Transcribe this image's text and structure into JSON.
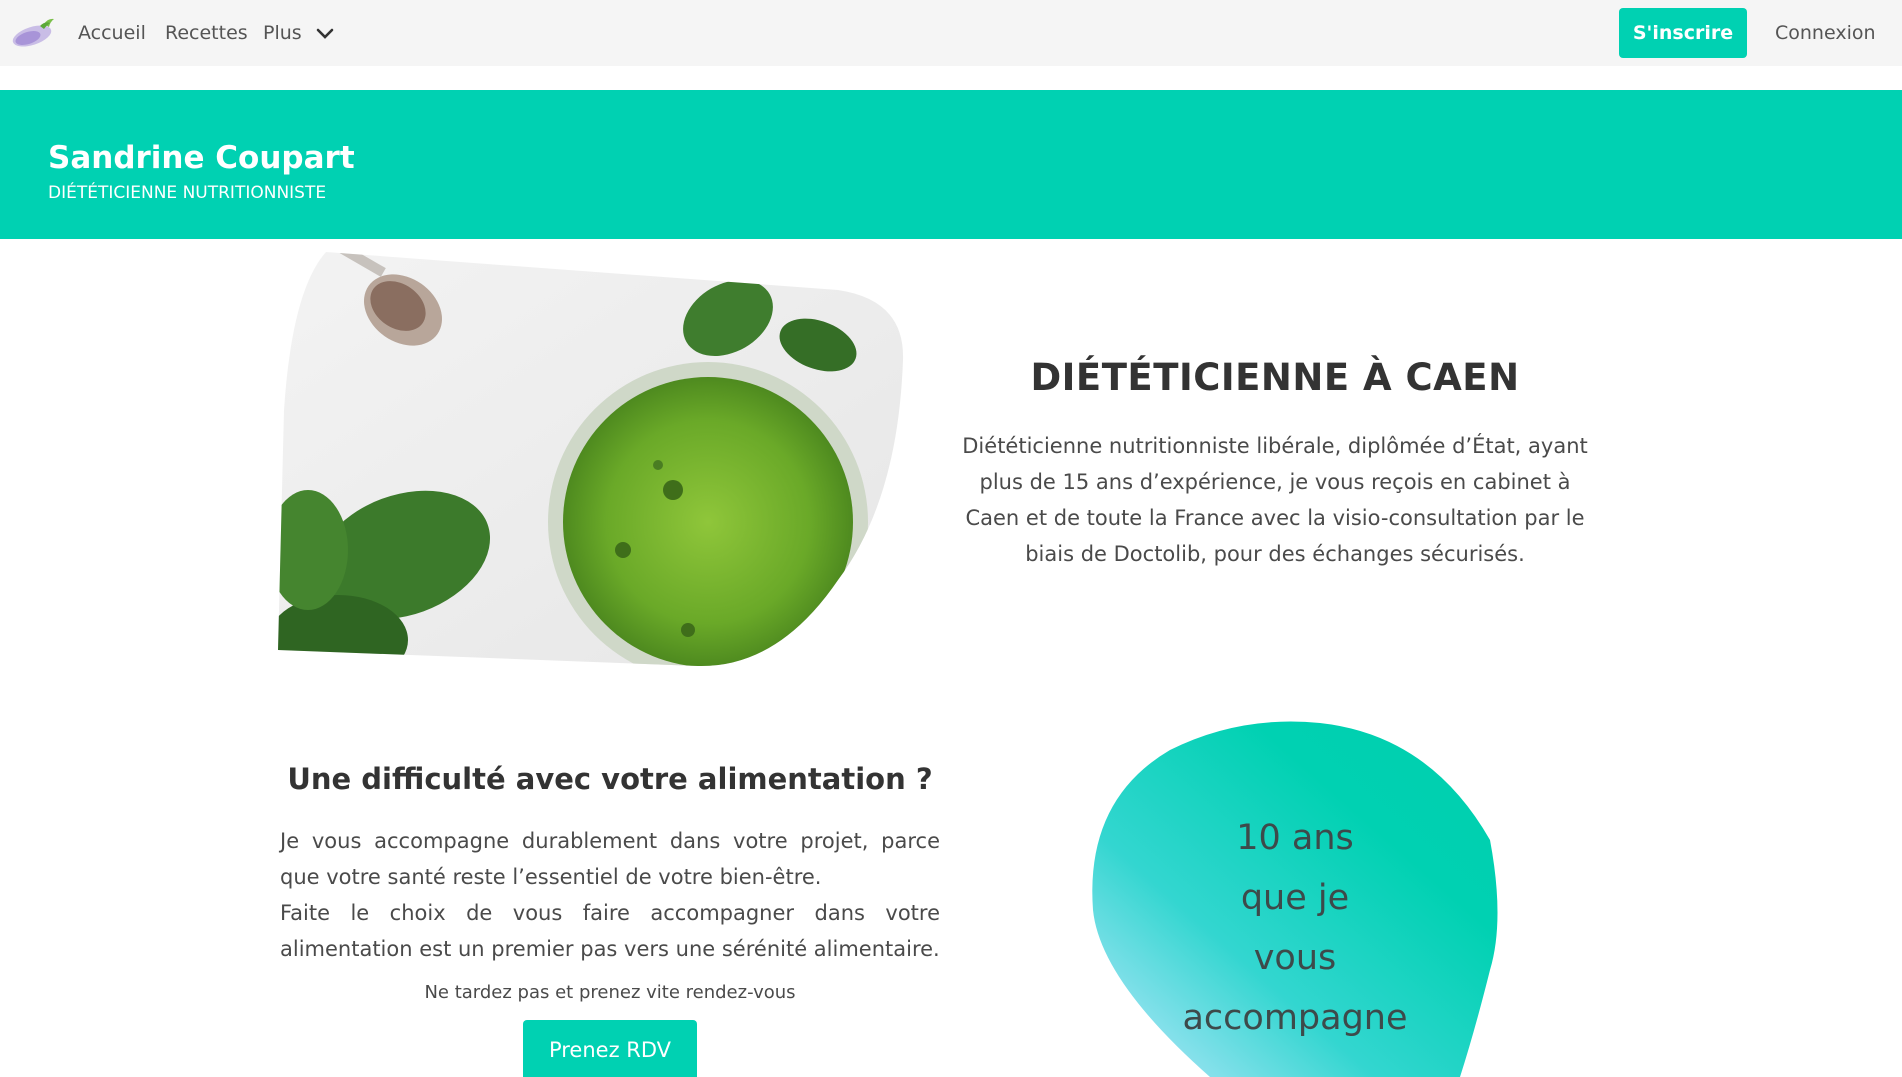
{
  "navbar": {
    "logo_icon": "eggplant-logo-icon",
    "links": [
      "Accueil",
      "Recettes",
      "Plus"
    ],
    "more_icon": "chevron-down-icon",
    "signup_label": "S'inscrire",
    "login_label": "Connexion"
  },
  "hero": {
    "title": "Sandrine Coupart",
    "subtitle": "DIÉTÉTICIENNE NUTRITIONNISTE"
  },
  "intro": {
    "image_icon": "green-smoothie-image",
    "heading": "DIÉTÉTICIENNE À CAEN",
    "text": "Diététicienne nutritionniste libérale, diplômée d’État, ayant plus de 15 ans d’expérience, je vous reçois en cabinet à Caen et de toute la France avec la visio-consultation par le biais de Doctolib, pour des échanges sécurisés."
  },
  "difficulty": {
    "heading": "Une difficulté avec votre alimentation ?",
    "paragraph_1": "Je vous accompagne durablement dans votre projet, parce que votre santé reste l’essentiel de votre bien-être.",
    "paragraph_2": "Faite le choix de vous faire accompagner dans votre alimentation est un premier pas vers une sérénité alimentaire.",
    "note": "Ne tardez pas et prenez vite rendez-vous",
    "button_label": "Prenez RDV"
  },
  "experience_blob": {
    "lines": [
      "10 ans",
      "que je",
      "vous",
      "accompagne"
    ]
  },
  "colors": {
    "accent": "#00d1b2",
    "navbar_bg": "#f5f5f5",
    "blob_light": "#bfe8ff"
  }
}
